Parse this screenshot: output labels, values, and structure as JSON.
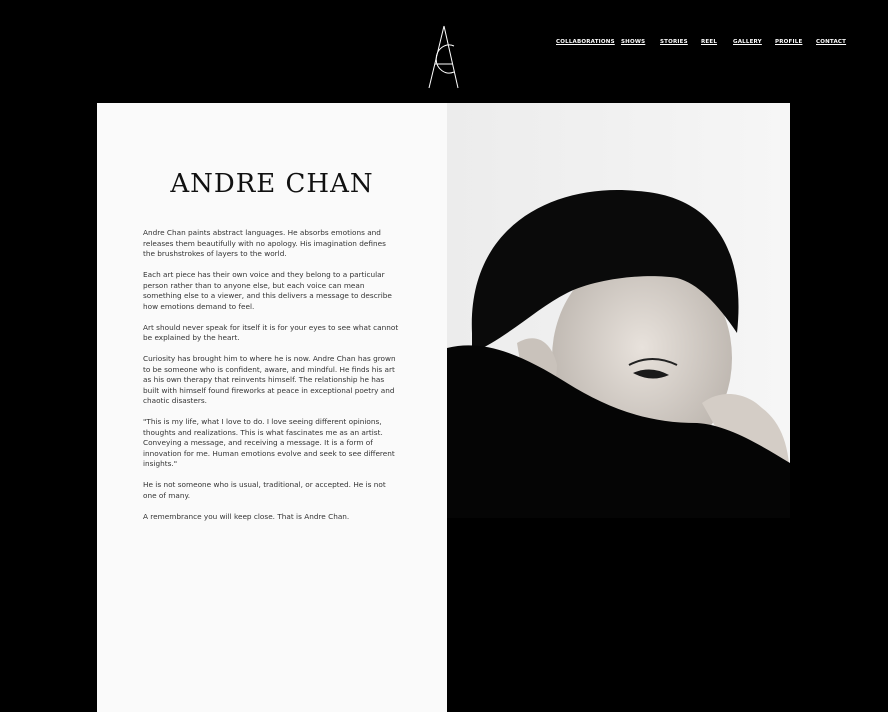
{
  "nav": {
    "items": [
      {
        "label": "COLLABORATIONS"
      },
      {
        "label": "SHOWS"
      },
      {
        "label": "STORIES"
      },
      {
        "label": "REEL"
      },
      {
        "label": "GALLERY"
      },
      {
        "label": "PROFILE"
      },
      {
        "label": "CONTACT"
      }
    ]
  },
  "hero": {
    "name": "ANDRE CHAN",
    "paragraphs": [
      "Andre Chan paints abstract languages. He absorbs emotions and releases them beautifully with no apology. His imagination defines the brushstrokes of layers to the world.",
      "Each art piece has their own voice and they belong to a particular person rather than to anyone else, but each voice can mean something else to a viewer, and this delivers a message to describe how emotions demand to feel.",
      "Art should never speak for itself   it is for your eyes to see what cannot be explained by the heart.",
      "Curiosity has brought him to where he is now. Andre Chan has grown to be someone who is confident, aware, and mindful. He finds his art as his own therapy that reinvents himself. The relationship he has built with himself found fireworks at peace in exceptional poetry and chaotic disasters.",
      "\"This is my life, what I love to do. I love seeing different opinions, thoughts and realizations. This is what fascinates me as an artist. Conveying a message, and receiving a message. It is a form of innovation for me. Human emotions evolve and seek to see different insights.\"",
      "He is not someone who is usual, traditional, or accepted. He is not one of many.",
      "A remembrance you will keep close. That is Andre Chan."
    ]
  },
  "colors": {
    "background": "#000000",
    "panel": "#fafafa",
    "text": "#333333",
    "nav_text": "#ffffff"
  },
  "icons": {
    "logo": "ac-monogram-logo",
    "portrait": "portrait-photo"
  }
}
